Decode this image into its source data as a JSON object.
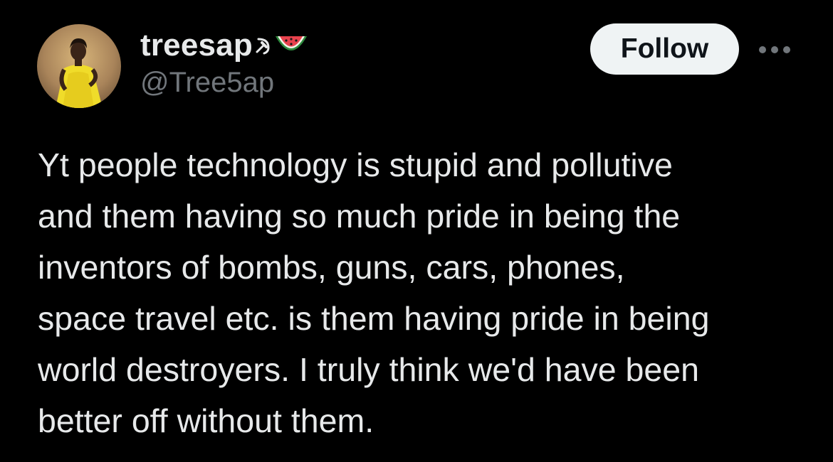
{
  "tweet": {
    "author": {
      "display_name": "treesap",
      "name_emojis": [
        "hammer-and-sickle-icon",
        "watermelon-icon"
      ],
      "handle": "@Tree5ap",
      "avatar": "profile-photo"
    },
    "follow_label": "Follow",
    "more_icon": "more-horizontal-icon",
    "text_lines": [
      "Yt people technology is stupid and pollutive",
      "and them having so much pride in being the",
      "inventors of bombs, guns, cars, phones,",
      "space travel etc. is them having pride in being",
      "world destroyers. I truly think we'd have been",
      "better off without them."
    ]
  },
  "colors": {
    "background": "#000000",
    "primary_text": "#e7e9ea",
    "secondary_text": "#71767b",
    "follow_bg": "#eff3f4",
    "follow_text": "#0f1419"
  }
}
